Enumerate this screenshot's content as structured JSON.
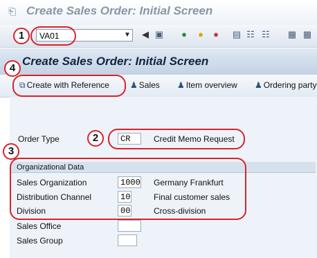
{
  "window": {
    "title": "Create Sales Order: Initial Screen"
  },
  "toolbar": {
    "command_value": "VA01"
  },
  "header": {
    "title": "Create Sales Order: Initial Screen"
  },
  "app_toolbar": {
    "create_with_reference": "Create with Reference",
    "sales": "Sales",
    "item_overview": "Item overview",
    "ordering_party": "Ordering party"
  },
  "order": {
    "label": "Order Type",
    "value": "CR",
    "description": "Credit Memo Request"
  },
  "org_data": {
    "title": "Organizational Data",
    "sales_org": {
      "label": "Sales Organization",
      "value": "1000",
      "description": "Germany Frankfurt"
    },
    "distribution_channel": {
      "label": "Distribution Channel",
      "value": "10",
      "description": "Final customer sales"
    },
    "division": {
      "label": "Division",
      "value": "00",
      "description": "Cross-division"
    },
    "sales_office": {
      "label": "Sales Office",
      "value": ""
    },
    "sales_group": {
      "label": "Sales Group",
      "value": ""
    }
  },
  "annotations": {
    "n1": "1",
    "n2": "2",
    "n3": "3",
    "n4": "4"
  },
  "colors": {
    "annotation": "#d8232a",
    "title_band": "#c3d2e4",
    "content_bg": "#eef3f9"
  }
}
